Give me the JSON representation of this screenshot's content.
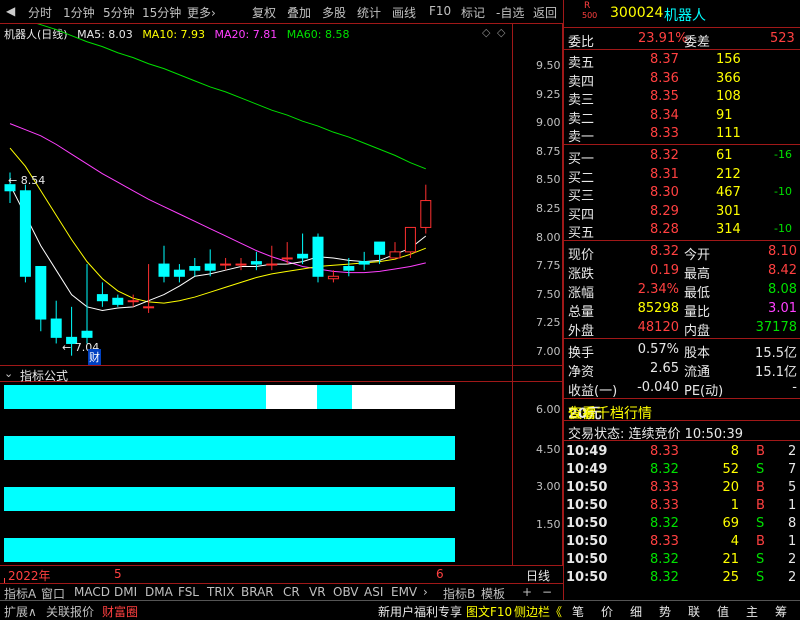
{
  "toolbar": {
    "back": "◀",
    "items": [
      "分时",
      "1分钟",
      "5分钟",
      "15分钟",
      "更多›"
    ],
    "right": [
      "复权",
      "叠加",
      "多股",
      "统计",
      "画线",
      "F10",
      "标记",
      "-自选",
      "返回"
    ]
  },
  "chart": {
    "title": "机器人(日线)",
    "ma5": "MA5: 8.03",
    "ma10": "MA10: 7.93",
    "ma20": "MA20: 7.81",
    "ma60": "MA60: 8.58",
    "high_label": "8.54",
    "low_label": "7.04",
    "cai": "财",
    "y_ticks": [
      "9.50",
      "9.25",
      "9.00",
      "8.75",
      "8.50",
      "8.25",
      "8.00",
      "7.75",
      "7.50",
      "7.25",
      "7.00"
    ],
    "colors": {
      "ma5": "#ffffff",
      "ma10": "#ffff00",
      "ma20": "#ff40ff",
      "ma60": "#00e000",
      "up": "#ff3030",
      "down": "#00ffff"
    }
  },
  "chart_data": {
    "type": "candlestick",
    "candles": [
      [
        8.45,
        8.55,
        8.4,
        8.3
      ],
      [
        8.4,
        8.45,
        7.7,
        7.65
      ],
      [
        7.78,
        7.78,
        7.35,
        7.25
      ],
      [
        7.35,
        7.5,
        7.2,
        7.15
      ],
      [
        7.2,
        7.45,
        7.15,
        7.05
      ],
      [
        7.25,
        7.8,
        7.2,
        7.15
      ],
      [
        7.55,
        7.65,
        7.5,
        7.45
      ],
      [
        7.52,
        7.55,
        7.47,
        7.45
      ],
      [
        7.5,
        7.55,
        7.5,
        7.45
      ],
      [
        7.45,
        7.8,
        7.45,
        7.4
      ],
      [
        7.8,
        7.95,
        7.7,
        7.65
      ],
      [
        7.75,
        7.8,
        7.7,
        7.65
      ],
      [
        7.78,
        7.85,
        7.75,
        7.7
      ],
      [
        7.8,
        7.92,
        7.75,
        7.7
      ],
      [
        7.8,
        7.85,
        7.8,
        7.75
      ],
      [
        7.8,
        7.85,
        7.8,
        7.75
      ],
      [
        7.82,
        7.9,
        7.8,
        7.75
      ],
      [
        7.8,
        7.95,
        7.8,
        7.75
      ],
      [
        7.85,
        7.98,
        7.85,
        7.8
      ],
      [
        7.88,
        8.05,
        7.85,
        7.8
      ],
      [
        8.02,
        8.05,
        7.7,
        7.65
      ],
      [
        7.68,
        7.75,
        7.7,
        7.65
      ],
      [
        7.78,
        7.85,
        7.75,
        7.7
      ],
      [
        7.82,
        7.9,
        7.8,
        7.75
      ],
      [
        7.98,
        7.98,
        7.88,
        7.8
      ],
      [
        7.85,
        7.98,
        7.9,
        7.85
      ],
      [
        7.9,
        8.1,
        8.1,
        7.85
      ],
      [
        8.1,
        8.45,
        8.32,
        8.05
      ]
    ],
    "ma5": [
      8.45,
      8.2,
      7.95,
      7.75,
      7.55,
      7.45,
      7.42,
      7.44,
      7.45,
      7.5,
      7.55,
      7.62,
      7.7,
      7.72,
      7.75,
      7.78,
      7.78,
      7.8,
      7.8,
      7.82,
      7.86,
      7.85,
      7.83,
      7.82,
      7.83,
      7.88,
      7.93,
      8.03
    ],
    "ma10": [
      8.75,
      8.6,
      8.4,
      8.2,
      8.0,
      7.82,
      7.68,
      7.58,
      7.52,
      7.49,
      7.48,
      7.5,
      7.53,
      7.57,
      7.61,
      7.65,
      7.69,
      7.72,
      7.74,
      7.76,
      7.78,
      7.79,
      7.8,
      7.81,
      7.82,
      7.84,
      7.88,
      7.93
    ],
    "ma20": [
      8.95,
      8.9,
      8.85,
      8.78,
      8.7,
      8.62,
      8.54,
      8.47,
      8.4,
      8.33,
      8.27,
      8.21,
      8.15,
      8.09,
      8.03,
      7.97,
      7.91,
      7.86,
      7.82,
      7.78,
      7.76,
      7.74,
      7.73,
      7.73,
      7.74,
      7.76,
      7.78,
      7.81
    ],
    "ma60": [
      9.85,
      9.8,
      9.76,
      9.72,
      9.67,
      9.62,
      9.58,
      9.53,
      9.49,
      9.44,
      9.4,
      9.35,
      9.3,
      9.25,
      9.21,
      9.16,
      9.11,
      9.06,
      9.02,
      8.97,
      8.93,
      8.88,
      8.84,
      8.79,
      8.74,
      8.69,
      8.63,
      8.58
    ],
    "ylim": [
      6.9,
      9.7
    ]
  },
  "indicator": {
    "title": "指标公式",
    "ticks": [
      "6.00",
      "4.50",
      "3.00",
      "1.50"
    ]
  },
  "xaxis": {
    "year": "2022年",
    "m5": "5",
    "m6": "6",
    "period": "日线"
  },
  "bottom_tabs": [
    "指标A",
    "窗口",
    "MACD",
    "DMI",
    "DMA",
    "FSL",
    "TRIX",
    "BRAR",
    "CR",
    "VR",
    "OBV",
    "ASI",
    "EMV",
    "›",
    "指标B",
    "模板"
  ],
  "status": {
    "left": [
      "扩展∧",
      "关联报价",
      "财富圈"
    ],
    "mid": [
      "新用户福利专享",
      "图文F10",
      "侧边栏《"
    ],
    "right": [
      "笔",
      "价",
      "细",
      "势",
      "联",
      "值",
      "主",
      "筹"
    ]
  },
  "quote": {
    "r_badge": "R",
    "r_num": "500",
    "code": "300024",
    "name": "机器人",
    "weibi_lbl": "委比",
    "weibi": "23.91%",
    "weicha_lbl": "委差",
    "weicha": "523",
    "sells": [
      {
        "lbl": "卖五",
        "price": "8.37",
        "vol": "156"
      },
      {
        "lbl": "卖四",
        "price": "8.36",
        "vol": "366"
      },
      {
        "lbl": "卖三",
        "price": "8.35",
        "vol": "108"
      },
      {
        "lbl": "卖二",
        "price": "8.34",
        "vol": "91"
      },
      {
        "lbl": "卖一",
        "price": "8.33",
        "vol": "111"
      }
    ],
    "buys": [
      {
        "lbl": "买一",
        "price": "8.32",
        "vol": "61",
        "chg": "-16"
      },
      {
        "lbl": "买二",
        "price": "8.31",
        "vol": "212",
        "chg": ""
      },
      {
        "lbl": "买三",
        "price": "8.30",
        "vol": "467",
        "chg": "-10"
      },
      {
        "lbl": "买四",
        "price": "8.29",
        "vol": "301",
        "chg": ""
      },
      {
        "lbl": "买五",
        "price": "8.28",
        "vol": "314",
        "chg": "-10"
      }
    ],
    "stats": [
      {
        "l1": "现价",
        "v1": "8.32",
        "l2": "今开",
        "v2": "8.10",
        "c1": "red",
        "c2": "red"
      },
      {
        "l1": "涨跌",
        "v1": "0.19",
        "l2": "最高",
        "v2": "8.42",
        "c1": "red",
        "c2": "red"
      },
      {
        "l1": "涨幅",
        "v1": "2.34%",
        "l2": "最低",
        "v2": "8.08",
        "c1": "red",
        "c2": "green"
      },
      {
        "l1": "总量",
        "v1": "85298",
        "l2": "量比",
        "v2": "3.01",
        "c1": "yellow",
        "c2": "magenta"
      },
      {
        "l1": "外盘",
        "v1": "48120",
        "l2": "内盘",
        "v2": "37178",
        "c1": "red",
        "c2": "green"
      }
    ],
    "stats2": [
      {
        "l1": "换手",
        "v1": "0.57%",
        "l2": "股本",
        "v2": "15.5亿"
      },
      {
        "l1": "净资",
        "v1": "2.65",
        "l2": "流通",
        "v2": "15.1亿"
      },
      {
        "l1": "收益(一)",
        "v1": "-0.040",
        "l2": "PE(动)",
        "v2": "-"
      }
    ],
    "promo_a": "仅需",
    "promo_b": "20元",
    "promo_c": "查看千档行情",
    "trade_state": "交易状态: 连续竞价 10:50:39",
    "ticks": [
      {
        "t": "10:49",
        "p": "8.33",
        "v": "8",
        "s": "B",
        "n": "2",
        "c": "red"
      },
      {
        "t": "10:49",
        "p": "8.32",
        "v": "52",
        "s": "S",
        "n": "7",
        "c": "green"
      },
      {
        "t": "10:50",
        "p": "8.33",
        "v": "20",
        "s": "B",
        "n": "5",
        "c": "red"
      },
      {
        "t": "10:50",
        "p": "8.33",
        "v": "1",
        "s": "B",
        "n": "1",
        "c": "red"
      },
      {
        "t": "10:50",
        "p": "8.32",
        "v": "69",
        "s": "S",
        "n": "8",
        "c": "green"
      },
      {
        "t": "10:50",
        "p": "8.33",
        "v": "4",
        "s": "B",
        "n": "1",
        "c": "red"
      },
      {
        "t": "10:50",
        "p": "8.32",
        "v": "21",
        "s": "S",
        "n": "2",
        "c": "green"
      },
      {
        "t": "10:50",
        "p": "8.32",
        "v": "25",
        "s": "S",
        "n": "2",
        "c": "green"
      }
    ]
  }
}
